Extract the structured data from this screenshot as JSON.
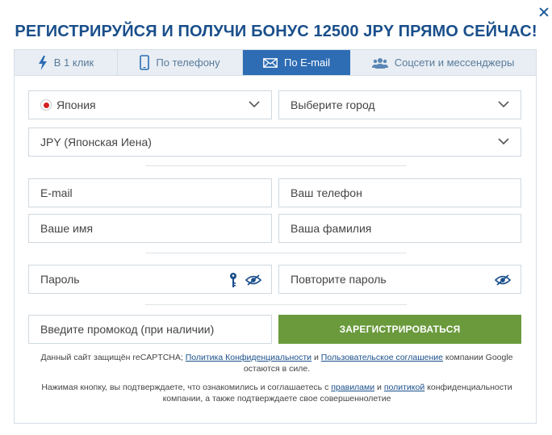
{
  "title": "РЕГИСТРИРУЙСЯ И ПОЛУЧИ БОНУС 12500 JPY ПРЯМО СЕЙЧАС!",
  "tabs": [
    {
      "label": "В 1 клик",
      "icon": "lightning-icon"
    },
    {
      "label": "По телефону",
      "icon": "phone-icon"
    },
    {
      "label": "По E-mail",
      "icon": "envelope-icon"
    },
    {
      "label": "Соцсети и мессенджеры",
      "icon": "users-icon"
    }
  ],
  "active_tab": "По E-mail",
  "form": {
    "country": "Япония",
    "city_placeholder": "Выберите город",
    "currency": "JPY (Японская Иена)",
    "email_placeholder": "E-mail",
    "phone_placeholder": "Ваш телефон",
    "first_name_placeholder": "Ваше имя",
    "last_name_placeholder": "Ваша фамилия",
    "password_placeholder": "Пароль",
    "repeat_password_placeholder": "Повторите пароль",
    "promo_placeholder": "Введите промокод (при наличии)",
    "submit_label": "ЗАРЕГИСТРИРОВАТЬСЯ"
  },
  "recaptcha": {
    "prefix": "Данный сайт защищён reCAPTCHA;",
    "privacy_link": "Политика Конфиденциальности",
    "and": "и",
    "terms_link": "Пользовательское соглашение",
    "suffix": "компании Google остаются в силе."
  },
  "consent": {
    "prefix": "Нажимая кнопку, вы подтверждаете, что ознакомились и соглашаетесь с",
    "rules_link": "правилами",
    "and": "и",
    "policy_link": "политикой",
    "suffix": "конфиденциальности компании, а также подтверждаете свое совершеннолетие"
  },
  "colors": {
    "accent": "#2e6db4",
    "title": "#1a4f8b",
    "button": "#6a9a3c"
  }
}
